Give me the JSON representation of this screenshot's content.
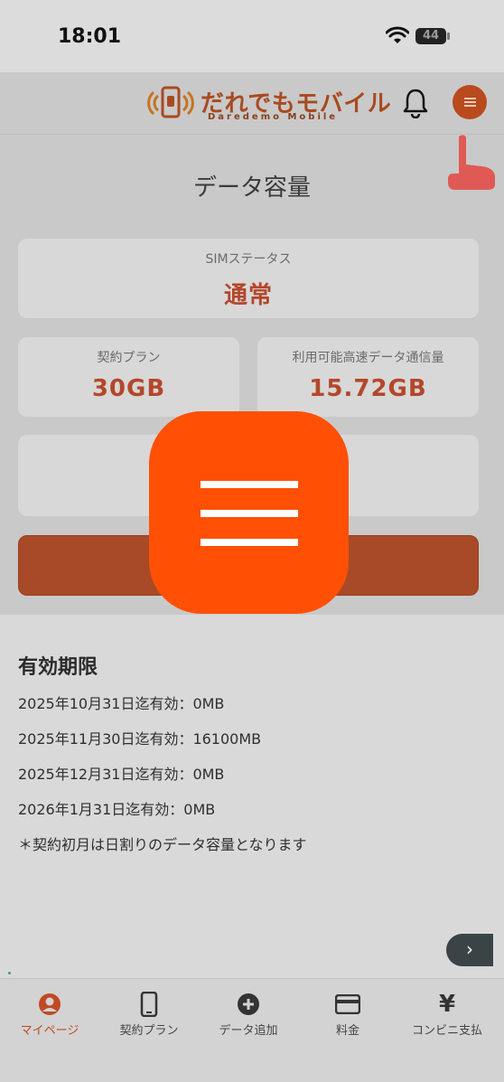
{
  "status_bar": {
    "time": "18:01",
    "battery": "44"
  },
  "header": {
    "logo_text": "だれでもモバイル",
    "logo_sub": "Daredemo Mobile"
  },
  "page": {
    "title": "データ容量"
  },
  "sim_status": {
    "label": "SIMステータス",
    "value": "通常"
  },
  "plan": {
    "label": "契約プラン",
    "value": "30GB"
  },
  "remaining": {
    "label": "利用可能高速データ通信量",
    "value": "15.72GB"
  },
  "expiry": {
    "title": "有効期限",
    "rows": [
      "2025年10月31日迄有効：0MB",
      "2025年11月30日迄有効：16100MB",
      "2025年12月31日迄有効：0MB",
      "2026年1月31日迄有効：0MB"
    ],
    "note": "＊契約初月は日割りのデータ容量となります"
  },
  "tabs": [
    {
      "label": "マイページ",
      "icon": "user-icon"
    },
    {
      "label": "契約プラン",
      "icon": "phone-icon"
    },
    {
      "label": "データ追加",
      "icon": "plus-circle-icon"
    },
    {
      "label": "料金",
      "icon": "credit-card-icon"
    },
    {
      "label": "コンビニ支払",
      "icon": "yen-icon"
    }
  ],
  "colors": {
    "accent": "#ff5005",
    "brand": "#b84a1e",
    "value_text": "#b4472b"
  }
}
